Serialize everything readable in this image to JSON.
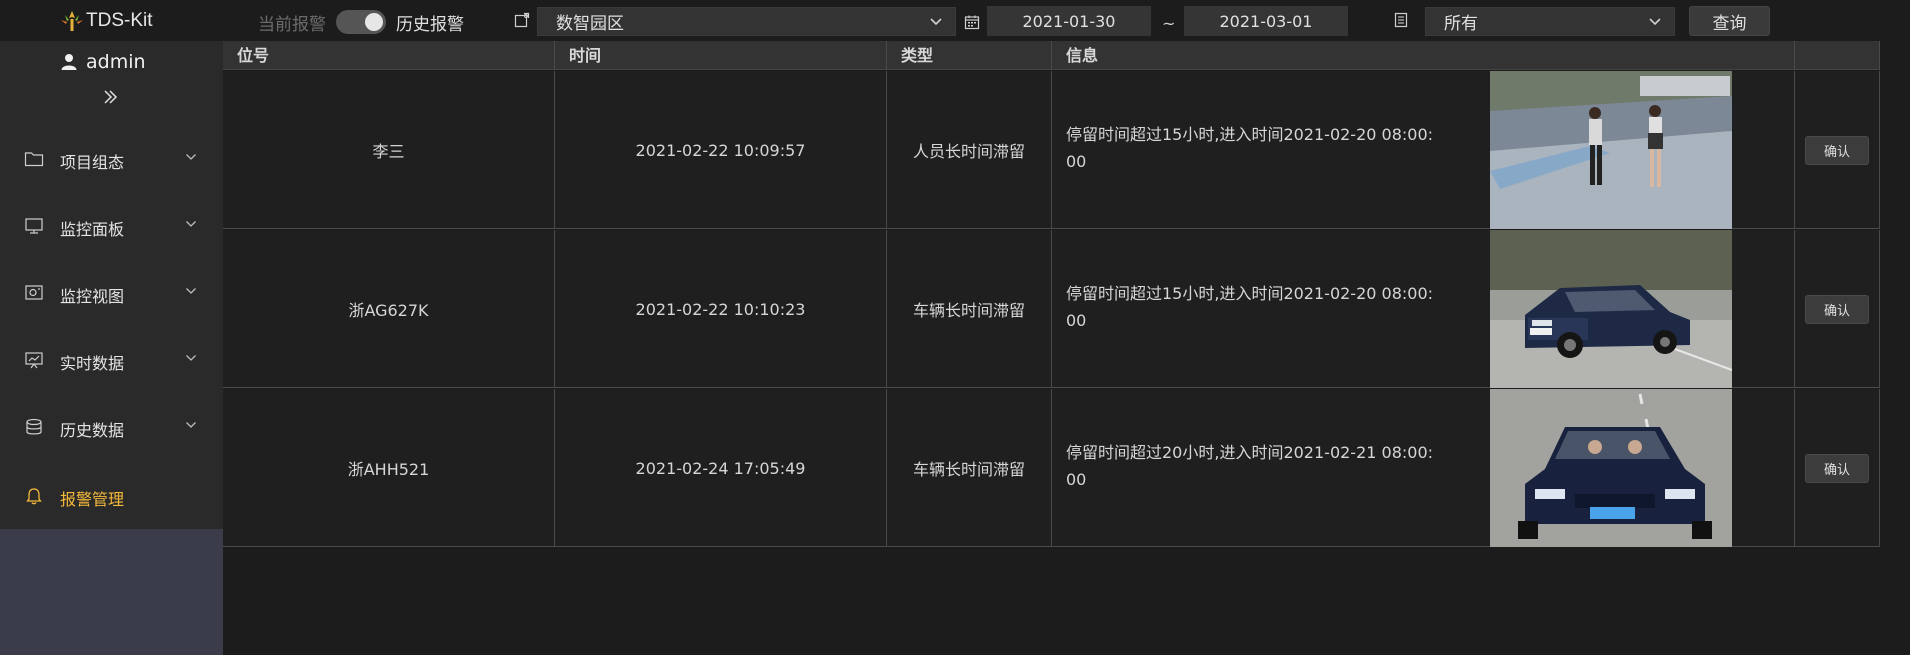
{
  "app": {
    "title": "TDS-Kit"
  },
  "toolbar": {
    "current_alarm_label": "当前报警",
    "history_alarm_label": "历史报警",
    "area_select_value": "数智园区",
    "date_start": "2021-01-30",
    "date_separator": "~",
    "date_end": "2021-03-01",
    "type_select_value": "所有",
    "query_label": "查询"
  },
  "sidebar": {
    "user_name": "admin",
    "items": [
      {
        "label": "项目组态",
        "icon": "folder-icon"
      },
      {
        "label": "监控面板",
        "icon": "monitor-icon"
      },
      {
        "label": "监控视图",
        "icon": "camera-view-icon"
      },
      {
        "label": "实时数据",
        "icon": "presentation-chart-icon"
      },
      {
        "label": "历史数据",
        "icon": "database-icon"
      },
      {
        "label": "报警管理",
        "icon": "bell-icon"
      }
    ],
    "active_color": "#f5b93b"
  },
  "table": {
    "headers": [
      "位号",
      "时间",
      "类型",
      "信息"
    ],
    "rows": [
      {
        "tag": "李三",
        "time": "2021-02-22 10:09:57",
        "type": "人员长时间滞留",
        "info": "停留时间超过15小时,进入时间2021-02-20 08:00:00",
        "image": "pedestrians-photo",
        "action": "确认"
      },
      {
        "tag": "浙AG627K",
        "time": "2021-02-22 10:10:23",
        "type": "车辆长时间滞留",
        "info": "停留时间超过15小时,进入时间2021-02-20 08:00:00",
        "image": "suv-photo",
        "action": "确认"
      },
      {
        "tag": "浙AHH521",
        "time": "2021-02-24 17:05:49",
        "type": "车辆长时间滞留",
        "info": "停留时间超过20小时,进入时间2021-02-21 08:00:00",
        "image": "car-front-photo",
        "action": "确认"
      }
    ]
  }
}
